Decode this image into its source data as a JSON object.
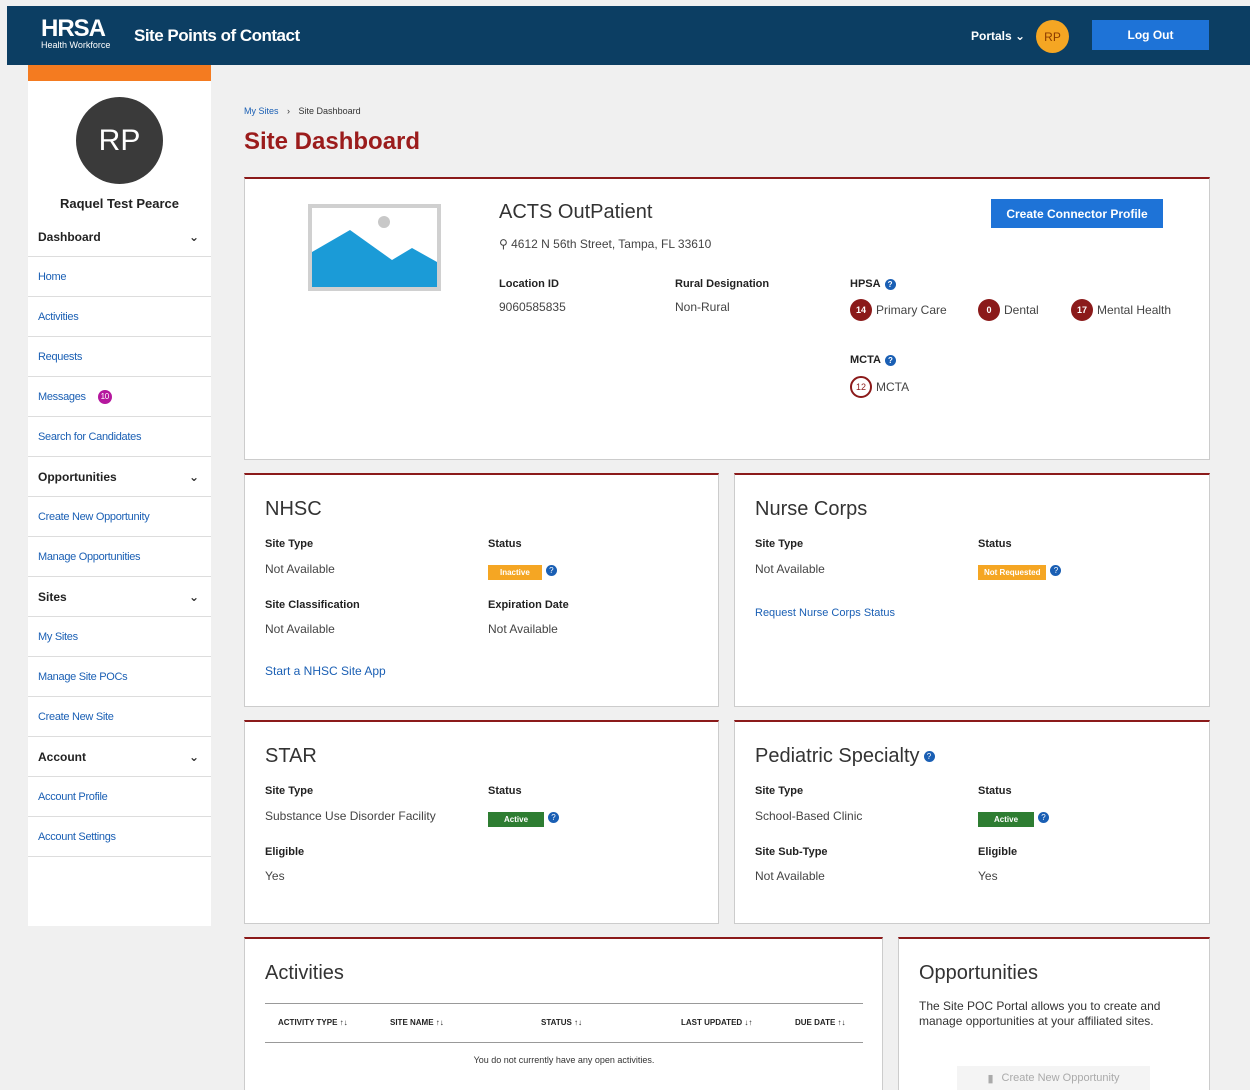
{
  "header": {
    "logo_main": "HRSA",
    "logo_sub": "Health Workforce",
    "title": "Site Points of Contact",
    "portals_label": "Portals",
    "user_initials": "RP",
    "logout_label": "Log Out"
  },
  "sidebar": {
    "initials": "RP",
    "name": "Raquel Test Pearce",
    "sections": [
      {
        "label": "Dashboard",
        "items": [
          "Home",
          "Activities",
          "Requests",
          "Messages",
          "Search for Candidates"
        ]
      },
      {
        "label": "Opportunities",
        "items": [
          "Create New Opportunity",
          "Manage Opportunities"
        ]
      },
      {
        "label": "Sites",
        "items": [
          "My Sites",
          "Manage Site POCs",
          "Create New Site"
        ]
      },
      {
        "label": "Account",
        "items": [
          "Account Profile",
          "Account Settings"
        ]
      }
    ],
    "messages_count": "10"
  },
  "breadcrumb": {
    "parent": "My Sites",
    "separator": "›",
    "current": "Site Dashboard"
  },
  "page_title": "Site Dashboard",
  "site": {
    "name": "ACTS OutPatient",
    "address": "4612 N 56th Street, Tampa, FL 33610",
    "create_connector_label": "Create Connector Profile",
    "location_id_label": "Location ID",
    "location_id": "9060585835",
    "rural_label": "Rural Designation",
    "rural_value": "Non-Rural",
    "hpsa_label": "HPSA",
    "hpsa": [
      {
        "count": "14",
        "label": "Primary Care"
      },
      {
        "count": "0",
        "label": "Dental"
      },
      {
        "count": "17",
        "label": "Mental Health"
      }
    ],
    "mcta_label": "MCTA",
    "mcta_count": "12",
    "mcta_value": "MCTA"
  },
  "nhsc": {
    "title": "NHSC",
    "site_type_label": "Site Type",
    "site_type": "Not Available",
    "status_label": "Status",
    "status": "Inactive",
    "classification_label": "Site Classification",
    "classification": "Not Available",
    "expiration_label": "Expiration Date",
    "expiration": "Not Available",
    "link": "Start a NHSC Site App"
  },
  "nurse": {
    "title": "Nurse Corps",
    "site_type_label": "Site Type",
    "site_type": "Not Available",
    "status_label": "Status",
    "status": "Not Requested",
    "link": "Request Nurse Corps Status"
  },
  "star": {
    "title": "STAR",
    "site_type_label": "Site Type",
    "site_type": "Substance Use Disorder Facility",
    "status_label": "Status",
    "status": "Active",
    "eligible_label": "Eligible",
    "eligible": "Yes"
  },
  "pediatric": {
    "title": "Pediatric Specialty",
    "site_type_label": "Site Type",
    "site_type": "School-Based Clinic",
    "status_label": "Status",
    "status": "Active",
    "subtype_label": "Site Sub-Type",
    "subtype": "Not Available",
    "eligible_label": "Eligible",
    "eligible": "Yes"
  },
  "activities": {
    "title": "Activities",
    "columns": [
      "ACTIVITY TYPE ↑↓",
      "SITE NAME ↑↓",
      "STATUS ↑↓",
      "LAST UPDATED ↓↑",
      "DUE DATE ↑↓"
    ],
    "empty": "You do not currently have any open activities."
  },
  "opportunities": {
    "title": "Opportunities",
    "description": "The Site POC Portal allows you to create and manage opportunities at your affiliated sites.",
    "button": "Create New Opportunity"
  },
  "colors": {
    "header": "#0c3e63",
    "accent": "#9b1c1c",
    "primary": "#1e73d7",
    "orange": "#f47b20"
  }
}
